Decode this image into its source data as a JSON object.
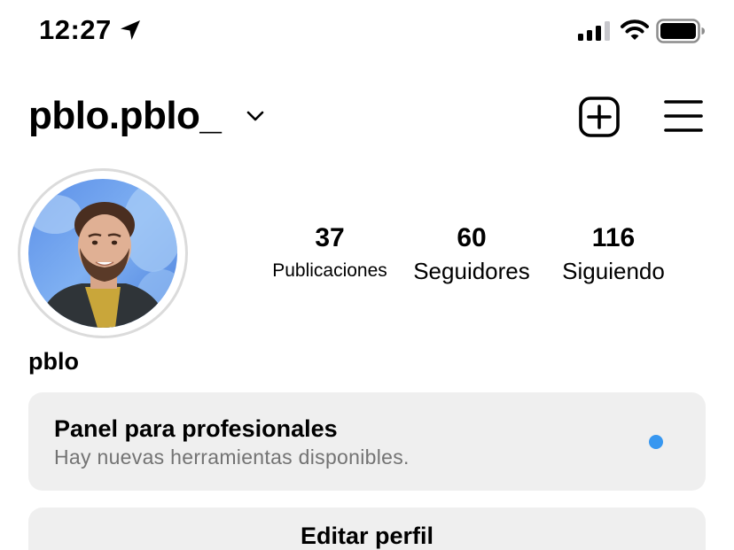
{
  "status_bar": {
    "time": "12:27",
    "location_icon": "location-arrow-icon",
    "signal_icon": "cellular-signal-icon",
    "wifi_icon": "wifi-icon",
    "battery_icon": "battery-icon"
  },
  "header": {
    "username": "pblo.pblo_",
    "chevron_icon": "chevron-down-icon",
    "new_post_icon": "plus-square-icon",
    "menu_icon": "hamburger-menu-icon"
  },
  "profile": {
    "display_name": "pblo",
    "stats": {
      "posts": {
        "value": "37",
        "label": "Publicaciones"
      },
      "followers": {
        "value": "60",
        "label": "Seguidores"
      },
      "following": {
        "value": "116",
        "label": "Siguiendo"
      }
    }
  },
  "pro_panel": {
    "title": "Panel para profesionales",
    "subtitle": "Hay nuevas herramientas disponibles.",
    "dot_color": "#3797f0"
  },
  "actions": {
    "edit_profile": "Editar perfil"
  },
  "colors": {
    "card_background": "#efefef",
    "muted_text": "#737373",
    "avatar_ring": "#dbdbdb"
  }
}
